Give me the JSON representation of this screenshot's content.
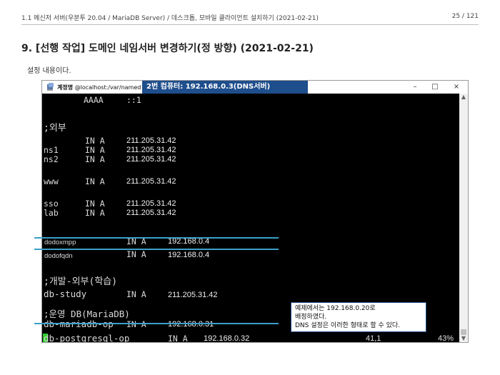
{
  "header": {
    "breadcrumb": "1.1 메신저 서버(우분투 20.04 / MariaDB Server) / 데스크톱, 모바일 클라이언트 설치하기 (2021-02-21)",
    "page_number": "25 / 121"
  },
  "title": "9. [선행 작업] 도메인 네임서버 변경하기(정 방향) (2021-02-21)",
  "intro_text": "설정 내용이다.",
  "window": {
    "title_user": "계정명",
    "title_path": "@localhost:/var/named",
    "banner": "2번 컴퓨터: 192.168.0.3(DNS서버)",
    "controls": {
      "minimize": "–",
      "maximize": "□",
      "close": "×"
    }
  },
  "terminal": {
    "lines": [
      {
        "id": "aaaa",
        "name": "AAAA",
        "type": "",
        "value": "::1"
      },
      {
        "id": "section_external",
        "comment": ";외부"
      },
      {
        "id": "rec1",
        "name": "",
        "type": "IN A",
        "value": "211.205.31.42"
      },
      {
        "id": "ns1",
        "name": "ns1",
        "type": "IN A",
        "value": "211.205.31.42"
      },
      {
        "id": "ns2",
        "name": "ns2",
        "type": "IN A",
        "value": "211.205.31.42"
      },
      {
        "id": "www",
        "name": "www",
        "type": "IN A",
        "value": "211.205.31.42"
      },
      {
        "id": "sso",
        "name": "sso",
        "type": "IN A",
        "value": "211.205.31.42"
      },
      {
        "id": "lab",
        "name": "lab",
        "type": "IN A",
        "value": "211.205.31.42"
      },
      {
        "id": "dodoxmpp",
        "name": "dodoxmpp",
        "type": "IN A",
        "value": "192.168.0.4"
      },
      {
        "id": "dodofqdn",
        "name": "dodofqdn",
        "type": "IN A",
        "value": "192.168.0.4"
      },
      {
        "id": "section_dev",
        "comment": ";개발-외부(학습)"
      },
      {
        "id": "dbstudy",
        "name": "db-study",
        "type": "IN A",
        "value": "211.205.31.42"
      },
      {
        "id": "section_ops",
        "comment": ";운영 DB(MariaDB)"
      },
      {
        "id": "dbmariadb",
        "name": "db-mariadb-op",
        "type": "IN A",
        "value": "192.168.0.31"
      },
      {
        "id": "dbpostgres",
        "name": "db-postgresql-op",
        "type": "IN A",
        "value": "192.168.0.32"
      }
    ],
    "status_position": "41,1",
    "status_percent": "43%"
  },
  "note": {
    "line1": "예제에서는 192.168.0.20로",
    "line2": "배정하였다.",
    "line3": "DNS 설정은 이러한 형태로 할 수 있다."
  },
  "colors": {
    "banner_bg": "#1f4e8c",
    "highlight_line": "#3aa0c8",
    "cursor": "#33cc33",
    "terminal_bg": "#000000"
  }
}
